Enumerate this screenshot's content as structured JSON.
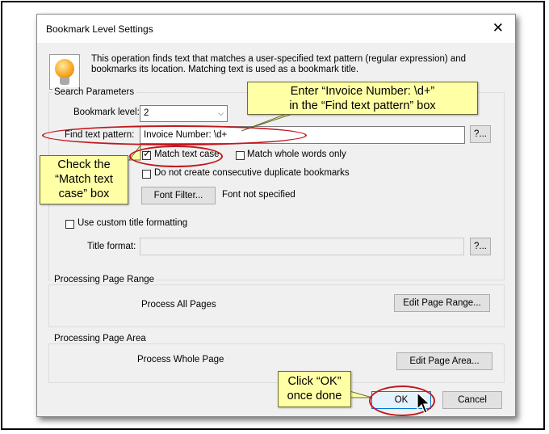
{
  "dialog": {
    "title": "Bookmark Level Settings",
    "close_glyph": "✕",
    "description": "This operation finds text that matches a user-specified text pattern (regular expression) and bookmarks its location. Matching text is used as a bookmark title.",
    "description_line1": "This operation finds text that matches a user-specified text pattern (regular expression) and",
    "description_line2": "bookmarks its location. Matching text is used as a bookmark title."
  },
  "search": {
    "group_title": "Search Parameters",
    "level_label": "Bookmark level:",
    "level_value": "2",
    "pattern_label": "Find text pattern:",
    "pattern_value": "Invoice Number: \\d+",
    "pattern_more": "?...",
    "match_case_label": "Match text case",
    "match_case_checked": true,
    "whole_words_label": "Match whole words only",
    "whole_words_checked": false,
    "no_dup_label": "Do not create consecutive duplicate bookmarks",
    "no_dup_checked": false,
    "font_filter_button": "Font Filter...",
    "font_status": "Font not specified",
    "custom_title_label": "Use custom title formatting",
    "custom_title_checked": false,
    "title_format_label": "Title format:",
    "title_format_value": "",
    "title_format_more": "?..."
  },
  "page_range": {
    "group_title": "Processing Page Range",
    "text": "Process All Pages",
    "button": "Edit Page Range..."
  },
  "page_area": {
    "group_title": "Processing Page Area",
    "text": "Process Whole Page",
    "button": "Edit Page Area..."
  },
  "footer": {
    "ok": "OK",
    "cancel": "Cancel"
  },
  "callouts": {
    "pattern_line1": "Enter “Invoice Number: \\d+”",
    "pattern_line2": "in the “Find text pattern” box",
    "case_line1": "Check the",
    "case_line2": "“Match text",
    "case_line3": "case” box",
    "ok_line1": "Click “OK”",
    "ok_line2": "once done"
  },
  "colors": {
    "callout_fill": "#ffffa6",
    "annotation_red": "#c0171d",
    "dialog_bg": "#f0f0f0"
  }
}
